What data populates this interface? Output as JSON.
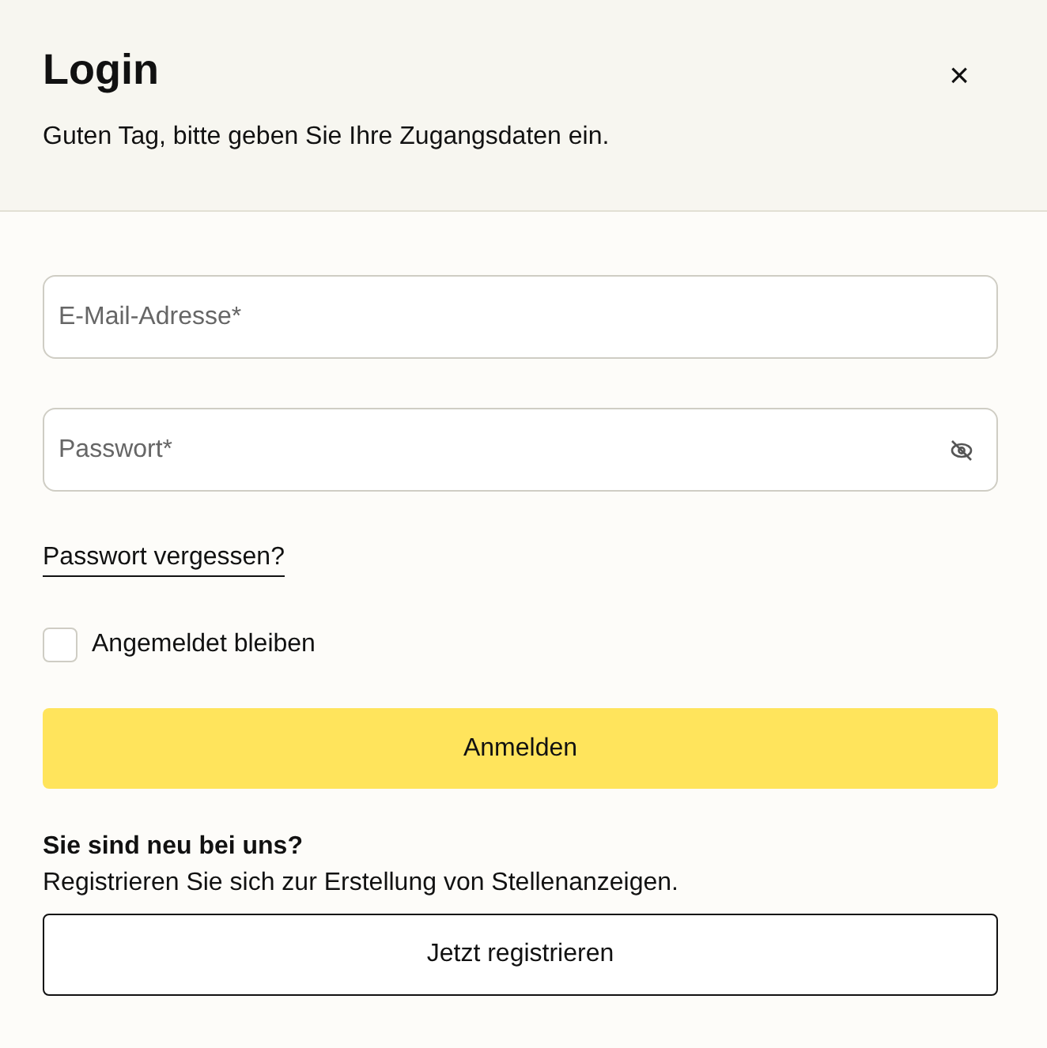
{
  "dialog": {
    "title": "Login",
    "close": "×",
    "subtitle": "Guten Tag, bitte geben Sie Ihre Zugangsdaten ein."
  },
  "fields": [
    {
      "kind": "text",
      "placeholder": "E-Mail-Adresse*"
    },
    {
      "kind": "password",
      "placeholder": "Passwort*"
    }
  ],
  "forgot_link": "Passwort vergessen?",
  "remember": {
    "label": "Angemeldet bleiben",
    "checked": false
  },
  "submit": "Anmelden",
  "register": {
    "heading": "Sie sind neu bei uns?",
    "text": "Registrieren Sie sich zur Erstellung von Stellenanzeigen.",
    "button": "Jetzt registrieren"
  }
}
